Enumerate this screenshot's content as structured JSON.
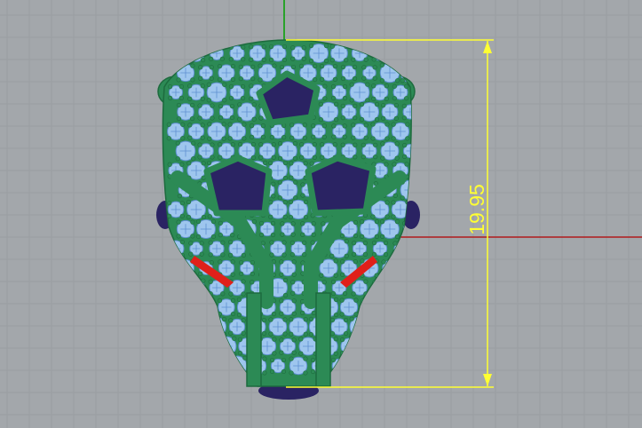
{
  "viewport": {
    "background_color": "#a3a7ab",
    "grid_minor_color": "#9a9ea2",
    "grid_major_color": "#8e9296",
    "x_axis_color": "#b30000",
    "y_axis_color": "#00a000"
  },
  "model": {
    "body_color": "#2c8a55",
    "body_edge_color": "#1d6b3e",
    "pave_color": "#9ec6ee",
    "pave_edge_color": "#5f8fd0",
    "stone_color": "#2a2363",
    "eye_color": "#e0201a"
  },
  "dimension": {
    "value": "19.95",
    "color": "#ffff33"
  }
}
